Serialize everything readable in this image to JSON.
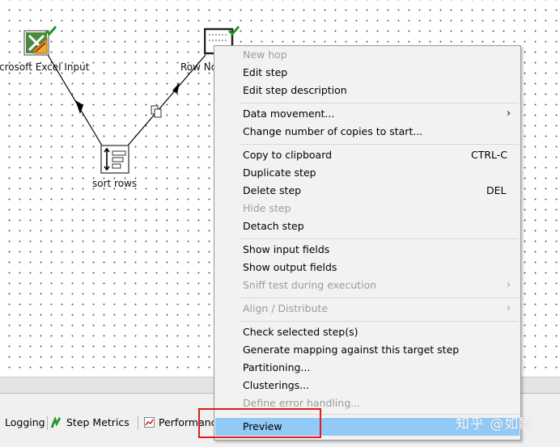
{
  "canvas": {
    "steps": [
      {
        "id": "excel",
        "label": "crosoft Excel Input"
      },
      {
        "id": "sort",
        "label": "sort rows"
      },
      {
        "id": "rownorm",
        "label": "Row No"
      }
    ]
  },
  "context_menu": {
    "items": [
      {
        "label": "New hop",
        "disabled": true
      },
      {
        "label": "Edit step"
      },
      {
        "label": "Edit step description"
      },
      {
        "sep": true
      },
      {
        "label": "Data movement...",
        "submenu": true
      },
      {
        "label": "Change number of copies to start..."
      },
      {
        "sep": true
      },
      {
        "label": "Copy to clipboard",
        "shortcut": "CTRL-C"
      },
      {
        "label": "Duplicate step"
      },
      {
        "label": "Delete step",
        "shortcut": "DEL"
      },
      {
        "label": "Hide step",
        "disabled": true
      },
      {
        "label": "Detach step"
      },
      {
        "sep": true
      },
      {
        "label": "Show input fields"
      },
      {
        "label": "Show output fields"
      },
      {
        "label": "Sniff test during execution",
        "disabled": true,
        "submenu": true
      },
      {
        "sep": true
      },
      {
        "label": "Align / Distribute",
        "disabled": true,
        "submenu": true
      },
      {
        "sep": true
      },
      {
        "label": "Check selected step(s)"
      },
      {
        "label": "Generate mapping against this target step"
      },
      {
        "label": "Partitioning..."
      },
      {
        "label": "Clusterings..."
      },
      {
        "label": "Define error handling...",
        "disabled": true
      },
      {
        "sep": true
      },
      {
        "label": "Preview",
        "highlighted": true
      }
    ],
    "submenu_arrow": "›"
  },
  "bottom_tabs": [
    {
      "label": "Logging"
    },
    {
      "label": "Step Metrics"
    },
    {
      "label": "Performanc"
    }
  ],
  "watermark": "知乎 @如影"
}
